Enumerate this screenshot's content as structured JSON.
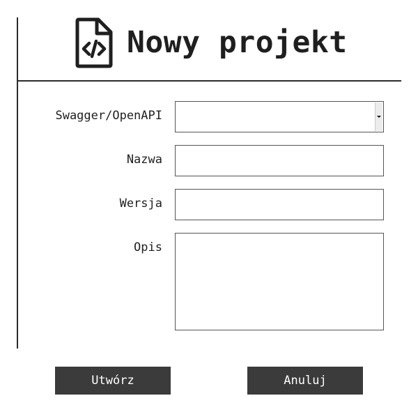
{
  "header": {
    "title": "Nowy projekt",
    "icon": "file-code-icon"
  },
  "form": {
    "swagger": {
      "label": "Swagger/OpenAPI",
      "value": ""
    },
    "name": {
      "label": "Nazwa",
      "value": ""
    },
    "version": {
      "label": "Wersja",
      "value": ""
    },
    "description": {
      "label": "Opis",
      "value": ""
    }
  },
  "actions": {
    "create_label": "Utwórz",
    "cancel_label": "Anuluj"
  },
  "colors": {
    "button_bg": "#3b3b3b",
    "button_text": "#ffffff",
    "text": "#1f1f1f",
    "rule": "#2b2b2b"
  }
}
